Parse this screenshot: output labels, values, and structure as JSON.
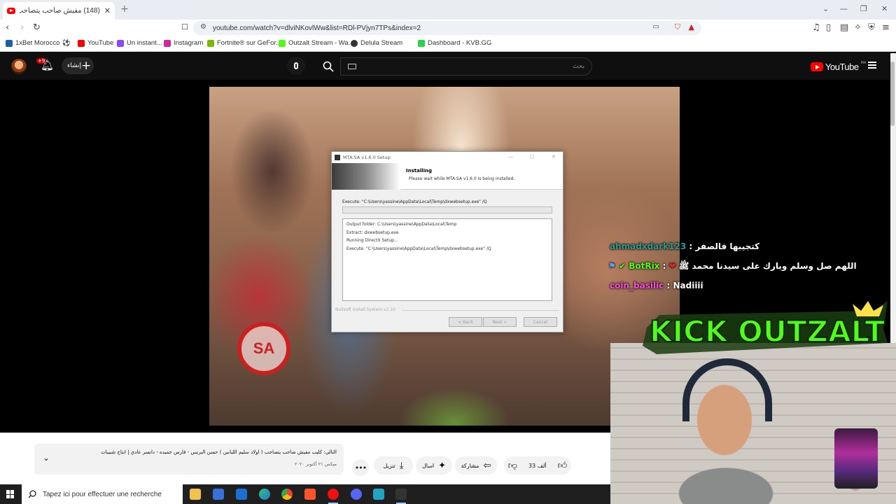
{
  "browser": {
    "tab_title": "(148) مفيش صاحب يتصاحب - YouTube",
    "url": "youtube.com/watch?v=dlviNKovlWw&list=RDl-PVjyn7TPs&index=2",
    "bookmarks": [
      {
        "label": "1xBet Morocco",
        "icon": "1xbet-icon",
        "color": "#1a5fa8"
      },
      {
        "label": "YouTube",
        "icon": "youtube-icon",
        "color": "#ff0000"
      },
      {
        "label": "Un instant...",
        "icon": "twitch-icon",
        "color": "#9146ff"
      },
      {
        "label": "Instagram",
        "icon": "instagram-icon",
        "color": "#d6249f"
      },
      {
        "label": "Fortnite® sur GeFor...",
        "icon": "nvidia-icon",
        "color": "#76b900"
      },
      {
        "label": "Outzalt Stream - Wa...",
        "icon": "kick-icon",
        "color": "#53fc18"
      },
      {
        "label": "Delula Stream",
        "icon": "stream-icon",
        "color": "#333333"
      },
      {
        "label": "Dashboard - KVB.GG",
        "icon": "kvb-icon",
        "color": "#2bd14d"
      }
    ]
  },
  "youtube": {
    "notification_count": "+9",
    "create_label": "إنشاء",
    "search_placeholder": "بحث",
    "logo_text": "YouTube",
    "region": "MA"
  },
  "installer": {
    "window_title": "MTA:SA v1.6.0 Setup",
    "heading": "Installing",
    "subheading": "Please wait while MTA:SA v1.6.0 is being installed.",
    "execute_line": "Execute: \"C:\\Users\\yassine\\AppData\\Local\\Temp\\dxwebsetup.exe\" /Q",
    "progress": 0.0,
    "log": [
      "Output folder: C:\\Users\\yassine\\AppData\\Local\\Temp",
      "Extract: dxwebsetup.exe",
      "Running DirectX Setup...",
      "Execute: \"C:\\Users\\yassine\\AppData\\Local\\Temp\\dxwebsetup.exe\" /Q"
    ],
    "brand": "Nullsoft Install System v3.10",
    "back_label": "< Back",
    "next_label": "Next >",
    "cancel_label": "Cancel"
  },
  "overlay": {
    "chat": [
      {
        "user": "ahmadxdark123",
        "message": "كتجيبها فالصفر",
        "user_color": "#2a9b8f"
      },
      {
        "user": "BotRix",
        "message": "اللهم صل وسلم وبارك على سيدنا محمد ﷺ",
        "user_color": "#53fc18"
      },
      {
        "user": "coin_basilic",
        "message": "Nadiiii",
        "user_color": "#ff4fd8"
      }
    ],
    "kick_text": "KICK OUTZALT"
  },
  "below_video": {
    "next_title": "التالي: كليب مفيش صاحب يتصاحب ( اولاد سليم اللبانين ) حسن البرنس - فارس حميده - دانسر عادي | انتاج شبيبات",
    "next_date": "ميكس ٢١ أكتوبر ٢٠٢٠",
    "actions": {
      "download": "تنزيل",
      "clip": "اسال",
      "share": "مشاركة",
      "likes": "33 ألف"
    }
  },
  "taskbar": {
    "search_placeholder": "Tapez ici pour effectuer une recherche"
  }
}
